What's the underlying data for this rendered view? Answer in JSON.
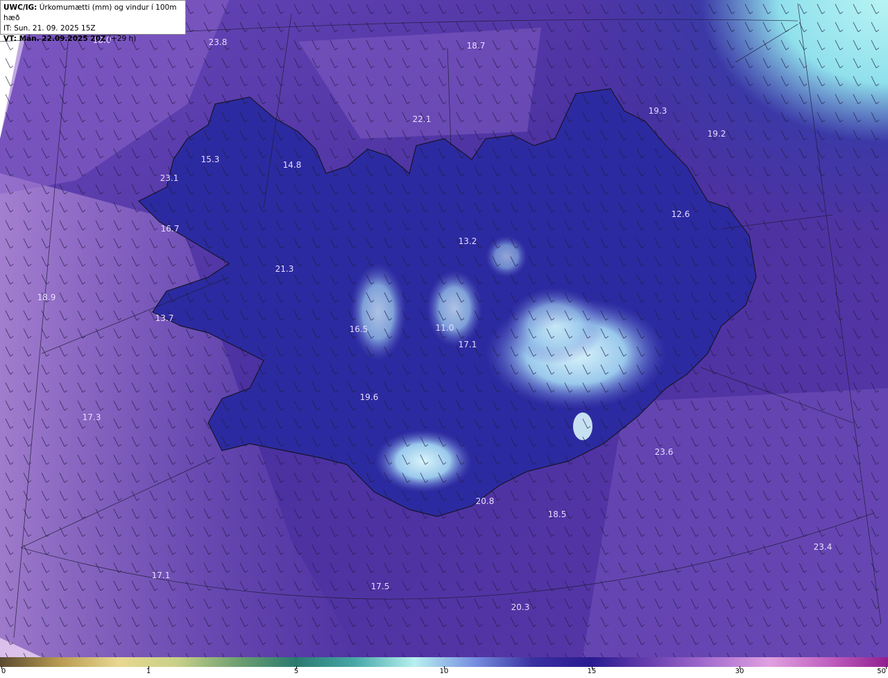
{
  "header": {
    "title_bold": "UWC/IG:",
    "title_rest": " Úrkomumætti (mm) og vindur í 100m hæð",
    "it_line": "IT: Sun. 21. 09. 2025 15Z",
    "vt_bold": "VT: Mán. 22.09.2025 20Z",
    "vt_rest": " (+29 h)"
  },
  "colors": {
    "background_main": "#5a3aa8",
    "sea_light": "#b48ad8",
    "land_dark": "#2a2a8a",
    "high_precip": "#bfe6f0",
    "corner_cyan": "#a8f0f0",
    "coastline": "#1a1a2a"
  },
  "map_labels": [
    {
      "text": "18.0"
    },
    {
      "text": "23.8"
    },
    {
      "text": "18.7"
    },
    {
      "text": "19.3"
    },
    {
      "text": "19.2"
    },
    {
      "text": "22.1"
    },
    {
      "text": "15.3"
    },
    {
      "text": "14.8"
    },
    {
      "text": "23.1"
    },
    {
      "text": "16.7"
    },
    {
      "text": "12.6"
    },
    {
      "text": "13.2"
    },
    {
      "text": "21.3"
    },
    {
      "text": "18.9"
    },
    {
      "text": "13.7"
    },
    {
      "text": "16.5"
    },
    {
      "text": "11.0"
    },
    {
      "text": "17.1"
    },
    {
      "text": "19.6"
    },
    {
      "text": "17.3"
    },
    {
      "text": "23.6"
    },
    {
      "text": "20.8"
    },
    {
      "text": "18.5"
    },
    {
      "text": "23.4"
    },
    {
      "text": "17.5"
    },
    {
      "text": "20.3"
    },
    {
      "text": "17.1"
    }
  ],
  "colorbar": {
    "ticks": [
      {
        "label": "0",
        "value": 0
      },
      {
        "label": "1",
        "value": 1
      },
      {
        "label": "5",
        "value": 5
      },
      {
        "label": "10",
        "value": 10
      },
      {
        "label": "15",
        "value": 15
      },
      {
        "label": "30",
        "value": 30
      },
      {
        "label": "50",
        "value": 50
      }
    ],
    "stops": [
      "#5a4a30",
      "#b89a50",
      "#e8d890",
      "#c8d088",
      "#70a070",
      "#2a7a70",
      "#48a8a8",
      "#b8f0f0",
      "#7890e0",
      "#3a30a0",
      "#2a1a90",
      "#6a40b0",
      "#a870d0",
      "#e0a0e0",
      "#c060c0",
      "#902090"
    ]
  }
}
